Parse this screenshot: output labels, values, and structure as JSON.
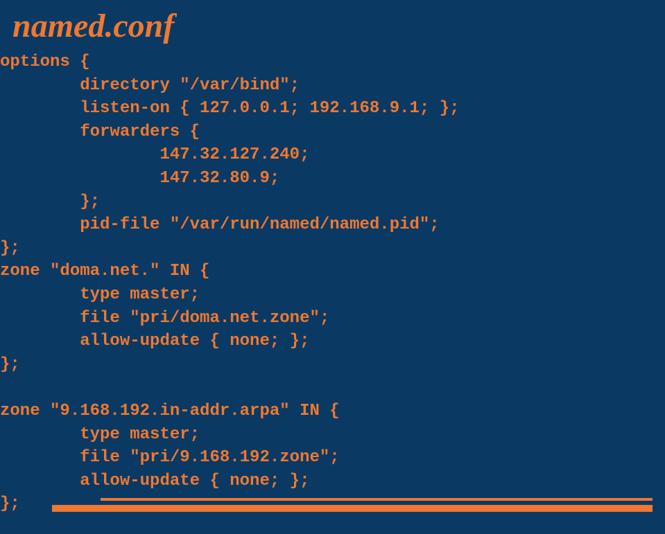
{
  "title": "named.conf",
  "code_lines": [
    "options {",
    "        directory \"/var/bind\";",
    "        listen-on { 127.0.0.1; 192.168.9.1; };",
    "        forwarders {",
    "                147.32.127.240;",
    "                147.32.80.9;",
    "        };",
    "        pid-file \"/var/run/named/named.pid\";",
    "};",
    "zone \"doma.net.\" IN {",
    "        type master;",
    "        file \"pri/doma.net.zone\";",
    "        allow-update { none; };",
    "};",
    "",
    "zone \"9.168.192.in-addr.arpa\" IN {",
    "        type master;",
    "        file \"pri/9.168.192.zone\";",
    "        allow-update { none; };",
    "};"
  ]
}
